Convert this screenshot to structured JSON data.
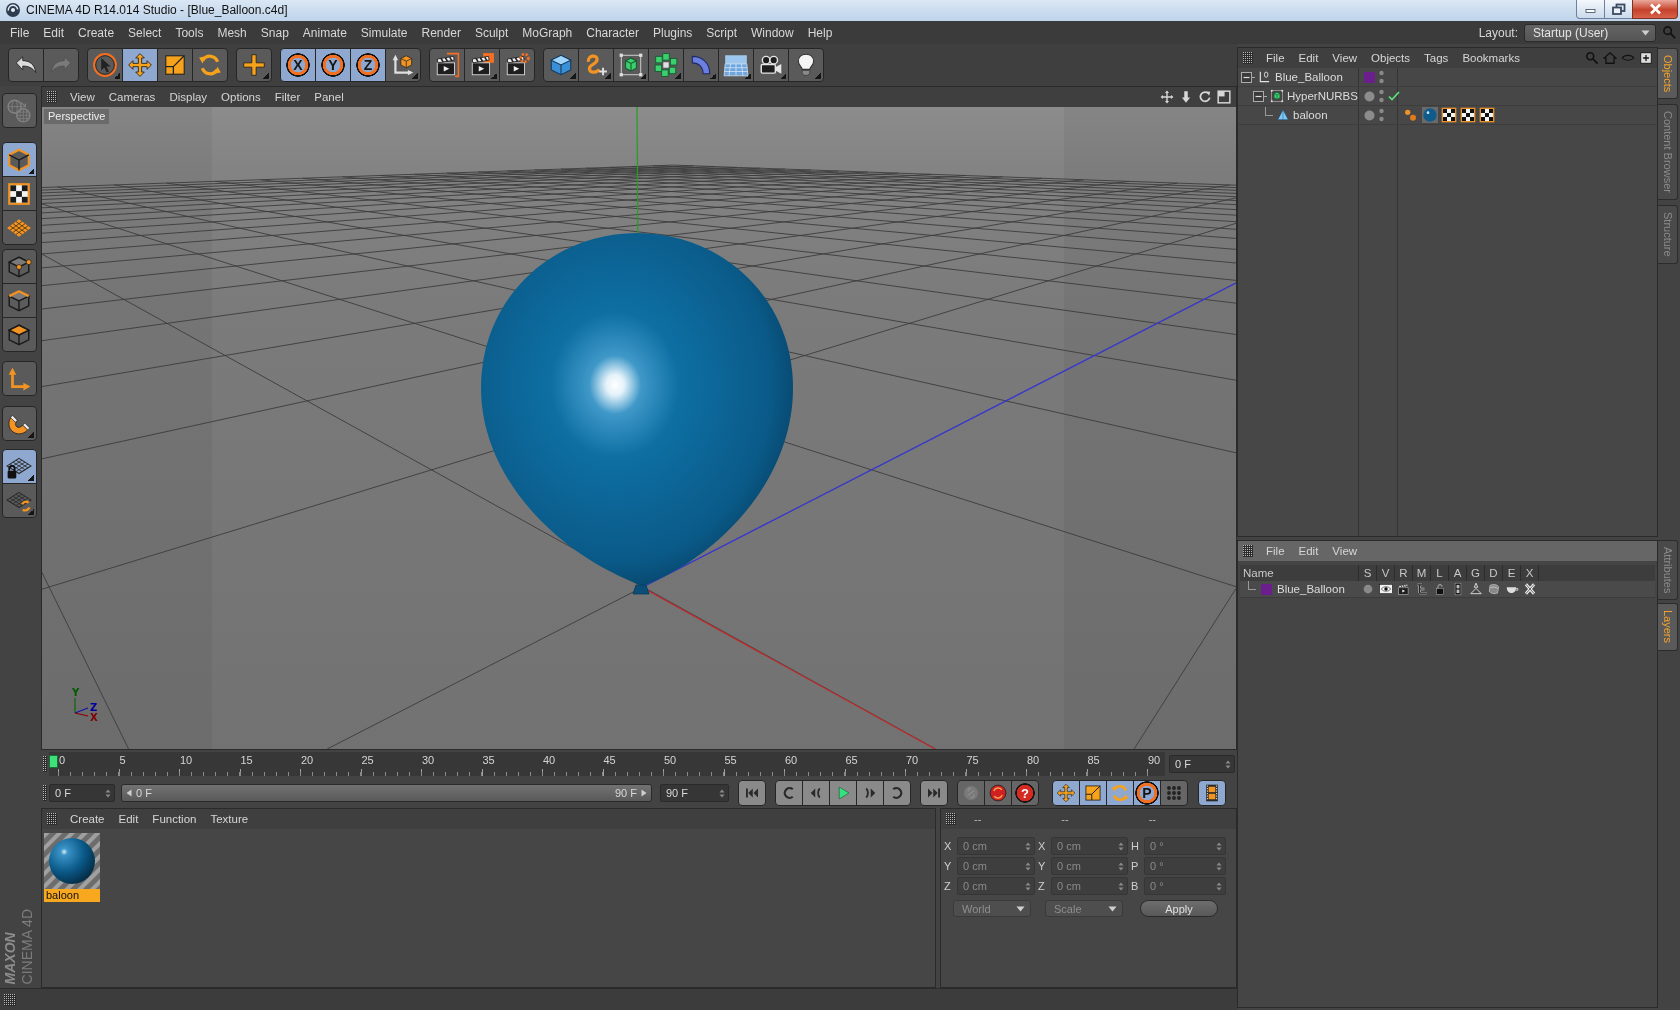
{
  "window": {
    "title": "CINEMA 4D R14.014 Studio - [Blue_Balloon.c4d]"
  },
  "menu_bar": {
    "items": [
      "File",
      "Edit",
      "Create",
      "Select",
      "Tools",
      "Mesh",
      "Snap",
      "Animate",
      "Simulate",
      "Render",
      "Sculpt",
      "MoGraph",
      "Character",
      "Plugins",
      "Script",
      "Window",
      "Help"
    ],
    "layout_label": "Layout:",
    "layout_value": "Startup (User)"
  },
  "toolbar": {
    "groups": [
      [
        {
          "kind": "undo",
          "disabled": false
        },
        {
          "kind": "redo",
          "disabled": true
        }
      ],
      [
        {
          "kind": "live-selection",
          "selected": false
        },
        {
          "kind": "move",
          "selected": true
        },
        {
          "kind": "scale",
          "selected": false
        },
        {
          "kind": "rotate",
          "selected": false
        }
      ],
      [
        {
          "kind": "recent-tool",
          "selected": false
        }
      ],
      [
        {
          "kind": "axis-lock",
          "glyph": "X",
          "selected": true
        },
        {
          "kind": "axis-lock",
          "glyph": "Y",
          "selected": true
        },
        {
          "kind": "axis-lock",
          "glyph": "Z",
          "selected": true
        },
        {
          "kind": "coordinate-system",
          "selected": false
        }
      ],
      [
        {
          "kind": "render-view"
        },
        {
          "kind": "render-to-viewer"
        },
        {
          "kind": "render-settings"
        }
      ],
      [
        {
          "kind": "cube"
        },
        {
          "kind": "spline"
        },
        {
          "kind": "subdivision"
        },
        {
          "kind": "cloner"
        },
        {
          "kind": "deformer"
        },
        {
          "kind": "floor"
        },
        {
          "kind": "camera"
        },
        {
          "kind": "light"
        }
      ]
    ]
  },
  "tool_palette": {
    "groups": [
      [
        {
          "kind": "make-editable",
          "disabled": true
        }
      ],
      [
        {
          "kind": "model",
          "selected": true
        },
        {
          "kind": "texture",
          "selected": false
        },
        {
          "kind": "workplane",
          "selected": false
        }
      ],
      [
        {
          "kind": "points",
          "selected": false
        },
        {
          "kind": "edges",
          "selected": false
        },
        {
          "kind": "polygons",
          "selected": false
        }
      ],
      [
        {
          "kind": "axis",
          "selected": false
        }
      ],
      [
        {
          "kind": "snap",
          "selected": false
        }
      ],
      [
        {
          "kind": "workplane-lock",
          "selected": true
        },
        {
          "kind": "locked-workplane",
          "selected": false
        }
      ]
    ]
  },
  "logo": {
    "brand": "MAXON",
    "product": "CINEMA 4D"
  },
  "viewport": {
    "menu": [
      "View",
      "Cameras",
      "Display",
      "Options",
      "Filter",
      "Panel"
    ],
    "camera": "Perspective",
    "gizmo_labels": [
      "Y",
      "Z",
      "X"
    ]
  },
  "timeline": {
    "ticks": [
      "0",
      "5",
      "10",
      "15",
      "20",
      "25",
      "30",
      "35",
      "40",
      "45",
      "50",
      "55",
      "60",
      "65",
      "70",
      "75",
      "80",
      "85",
      "90"
    ],
    "playhead": {
      "level": 0
    },
    "current_frame": "0 F"
  },
  "transport": {
    "start_field": "0 F",
    "range": {
      "start": "0 F",
      "end": "90 F",
      "level": 1
    },
    "end_field": "90 F",
    "playback": [
      {
        "kind": "go-start"
      },
      {
        "kind": "prev-key"
      },
      {
        "kind": "prev-frame"
      },
      {
        "kind": "play"
      },
      {
        "kind": "next-frame"
      },
      {
        "kind": "next-key"
      },
      {
        "kind": "go-end"
      }
    ],
    "recording": [
      {
        "kind": "keyframe-link",
        "disabled": true
      },
      {
        "kind": "record",
        "disabled": false
      },
      {
        "kind": "autokey",
        "glyph": "?",
        "disabled": false
      }
    ],
    "key_tracks": [
      {
        "kind": "position",
        "selected": true
      },
      {
        "kind": "scale",
        "selected": true
      },
      {
        "kind": "rotation",
        "selected": true
      },
      {
        "kind": "parameter",
        "glyph": "P",
        "selected": true
      },
      {
        "kind": "point-level",
        "selected": false
      }
    ],
    "timeline_toggle": {
      "kind": "timeline",
      "selected": true
    }
  },
  "material_manager": {
    "menu": [
      "Create",
      "Edit",
      "Function",
      "Texture"
    ],
    "materials": [
      {
        "name": "baloon",
        "selected": true
      }
    ]
  },
  "coordinates": {
    "disabled": true,
    "headers": [
      "--",
      "--",
      "--"
    ],
    "rows": [
      {
        "axis": "X",
        "position": "0 cm",
        "size_axis": "X",
        "size": "0 cm",
        "rotation_axis": "H",
        "rotation": "0 °"
      },
      {
        "axis": "Y",
        "position": "0 cm",
        "size_axis": "Y",
        "size": "0 cm",
        "rotation_axis": "P",
        "rotation": "0 °"
      },
      {
        "axis": "Z",
        "position": "0 cm",
        "size_axis": "Z",
        "size": "0 cm",
        "rotation_axis": "B",
        "rotation": "0 °"
      }
    ],
    "mode": "World",
    "size_mode": "Scale",
    "apply": "Apply"
  },
  "object_manager": {
    "menu": [
      "File",
      "Edit",
      "View",
      "Objects",
      "Tags",
      "Bookmarks"
    ],
    "objects": [
      {
        "name": "Blue_Balloon",
        "kind": "null",
        "color": "#6a1f8c",
        "expanded": true,
        "children": [
          {
            "name": "HyperNURBS",
            "kind": "subdivision",
            "expanded": true,
            "enabled": true,
            "children": [
              {
                "name": "baloon",
                "kind": "polygon",
                "tags": [
                  {
                    "kind": "phong"
                  },
                  {
                    "kind": "material"
                  },
                  {
                    "kind": "uvw"
                  },
                  {
                    "kind": "uvw"
                  },
                  {
                    "kind": "uvw"
                  }
                ]
              }
            ]
          }
        ]
      }
    ]
  },
  "layer_manager": {
    "menu": [
      "File",
      "Edit",
      "View"
    ],
    "columns": [
      "Name",
      "S",
      "V",
      "R",
      "M",
      "L",
      "A",
      "G",
      "D",
      "E",
      "X"
    ],
    "layers": [
      {
        "name": "Blue_Balloon",
        "color": "#6a1f8c",
        "switches": [
          {
            "kind": "solo",
            "on": false
          },
          {
            "kind": "view",
            "on": true
          },
          {
            "kind": "render",
            "on": true
          },
          {
            "kind": "manager",
            "on": true
          },
          {
            "kind": "locked",
            "on": true
          },
          {
            "kind": "animation",
            "on": true
          },
          {
            "kind": "generators",
            "on": true
          },
          {
            "kind": "deformers",
            "on": true
          },
          {
            "kind": "expressions",
            "on": true
          },
          {
            "kind": "xrefs",
            "on": true
          }
        ]
      }
    ]
  },
  "side_tabs": {
    "top": [
      {
        "label": "Objects",
        "selected": true
      },
      {
        "label": "Content Browser",
        "selected": false
      },
      {
        "label": "Structure",
        "selected": false
      }
    ],
    "bottom": [
      {
        "label": "Attributes",
        "selected": false
      },
      {
        "label": "Layers",
        "selected": true
      }
    ]
  }
}
